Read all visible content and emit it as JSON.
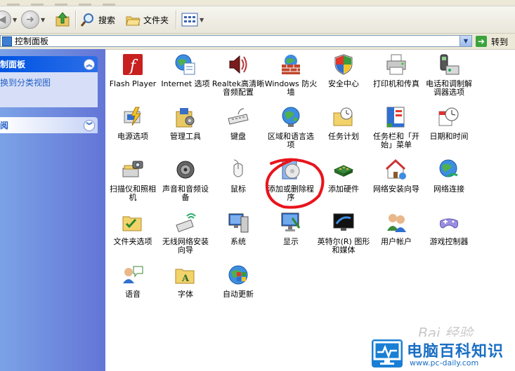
{
  "toolbar": {
    "back": "",
    "search_label": "搜索",
    "folders_label": "文件夹"
  },
  "address": {
    "value": "控制面板",
    "go_label": "转到"
  },
  "left_pane": {
    "panel1_title": "制面板",
    "panel1_link": "换到分类视图",
    "panel2_title": "阅"
  },
  "items": [
    {
      "label": "Flash Player",
      "icon": "flash-icon"
    },
    {
      "label": "Internet 选项",
      "icon": "internet-options-icon"
    },
    {
      "label": "Realtek高清晰音频配置",
      "icon": "realtek-audio-icon"
    },
    {
      "label": "Windows 防火墙",
      "icon": "firewall-icon"
    },
    {
      "label": "安全中心",
      "icon": "security-center-icon"
    },
    {
      "label": "打印机和传真",
      "icon": "printer-icon"
    },
    {
      "label": "电话和调制解调器选项",
      "icon": "phone-modem-icon"
    },
    {
      "label": "电源选项",
      "icon": "power-icon"
    },
    {
      "label": "管理工具",
      "icon": "admin-tools-icon"
    },
    {
      "label": "键盘",
      "icon": "keyboard-icon"
    },
    {
      "label": "区域和语言选项",
      "icon": "globe-icon"
    },
    {
      "label": "任务计划",
      "icon": "scheduled-tasks-icon"
    },
    {
      "label": "任务栏和「开始」菜单",
      "icon": "taskbar-icon"
    },
    {
      "label": "日期和时间",
      "icon": "clock-icon"
    },
    {
      "label": "扫描仪和照相机",
      "icon": "scanner-camera-icon"
    },
    {
      "label": "声音和音频设备",
      "icon": "speaker-icon"
    },
    {
      "label": "鼠标",
      "icon": "mouse-icon"
    },
    {
      "label": "添加或删除程序",
      "icon": "add-remove-programs-icon"
    },
    {
      "label": "添加硬件",
      "icon": "add-hardware-icon"
    },
    {
      "label": "网络安装向导",
      "icon": "network-wizard-icon"
    },
    {
      "label": "网络连接",
      "icon": "network-connections-icon"
    },
    {
      "label": "文件夹选项",
      "icon": "folder-options-icon"
    },
    {
      "label": "无线网络安装向导",
      "icon": "wireless-wizard-icon"
    },
    {
      "label": "系统",
      "icon": "system-icon"
    },
    {
      "label": "显示",
      "icon": "display-icon"
    },
    {
      "label": "英特尔(R) 图形和媒体",
      "icon": "intel-graphics-icon"
    },
    {
      "label": "用户帐户",
      "icon": "user-accounts-icon"
    },
    {
      "label": "游戏控制器",
      "icon": "game-controller-icon"
    },
    {
      "label": "语音",
      "icon": "speech-icon"
    },
    {
      "label": "字体",
      "icon": "fonts-icon"
    },
    {
      "label": "自动更新",
      "icon": "auto-update-icon"
    }
  ],
  "watermark": "Bai 经验",
  "logo": {
    "title": "电脑百科知识",
    "url": "www.pc-daily.com"
  },
  "colors": {
    "left_pane": "#6F8FE0",
    "panel_header": "#0054E3",
    "link": "#215DC6",
    "annotation": "#E8141C",
    "logo": "#1A6FC4"
  }
}
